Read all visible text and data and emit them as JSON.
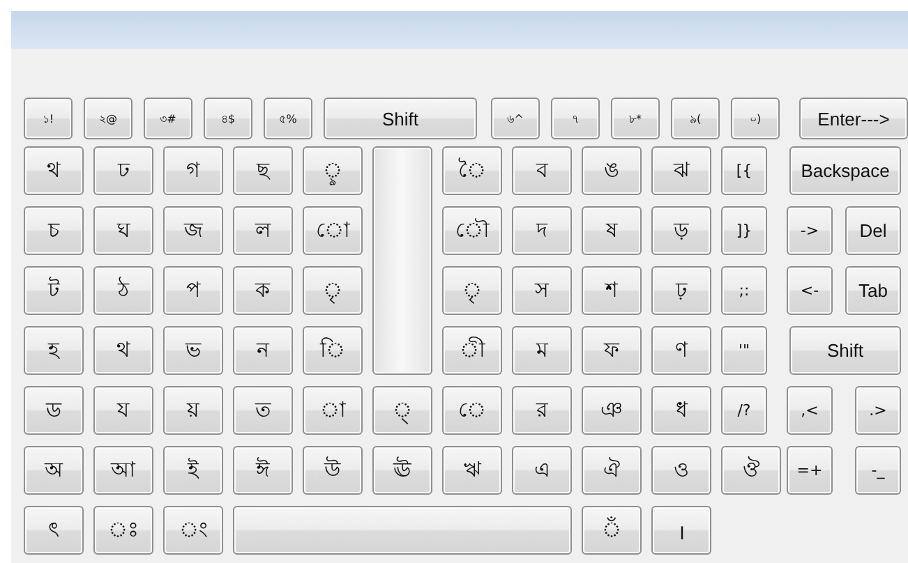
{
  "number_row": [
    {
      "label": "১!",
      "kind": "small"
    },
    {
      "label": "২@",
      "kind": "small"
    },
    {
      "label": "৩#",
      "kind": "small"
    },
    {
      "label": "৪$",
      "kind": "small"
    },
    {
      "label": "৫%",
      "kind": "small"
    },
    {
      "label": "Shift",
      "kind": "shift"
    },
    {
      "label": "৬^",
      "kind": "small"
    },
    {
      "label": "৭",
      "kind": "small"
    },
    {
      "label": "৮*",
      "kind": "small"
    },
    {
      "label": "৯(",
      "kind": "small"
    },
    {
      "label": "০)",
      "kind": "small"
    },
    {
      "label": "Enter--->",
      "kind": "enter"
    }
  ],
  "rows": [
    {
      "keys": [
        {
          "label": "থ",
          "kind": "letter"
        },
        {
          "label": "ঢ",
          "kind": "letter"
        },
        {
          "label": "গ",
          "kind": "letter"
        },
        {
          "label": "ছ",
          "kind": "letter"
        },
        {
          "label": "ৢ",
          "kind": "letter"
        },
        {
          "kind": "blank"
        },
        {
          "label": "ৈ",
          "kind": "letter"
        },
        {
          "label": "ব",
          "kind": "letter"
        },
        {
          "label": "ঙ",
          "kind": "letter"
        },
        {
          "label": "ঝ",
          "kind": "letter"
        },
        {
          "label": "[{",
          "kind": "punct"
        }
      ],
      "side": [
        {
          "label": "Backspace",
          "kind": "wide"
        }
      ]
    },
    {
      "keys": [
        {
          "label": "চ",
          "kind": "letter"
        },
        {
          "label": "ঘ",
          "kind": "letter"
        },
        {
          "label": "জ",
          "kind": "letter"
        },
        {
          "label": "ল",
          "kind": "letter"
        },
        {
          "label": "ো",
          "kind": "letter"
        },
        {
          "label": "ৌ",
          "kind": "letter"
        },
        {
          "label": "দ",
          "kind": "letter"
        },
        {
          "label": "ষ",
          "kind": "letter"
        },
        {
          "label": "ড়",
          "kind": "letter"
        },
        {
          "label": "]}",
          "kind": "punct"
        }
      ],
      "side": [
        {
          "label": "->",
          "kind": "punct"
        },
        {
          "label": "Del",
          "kind": "mid"
        }
      ]
    },
    {
      "keys": [
        {
          "label": "ট",
          "kind": "letter"
        },
        {
          "label": "ঠ",
          "kind": "letter"
        },
        {
          "label": "প",
          "kind": "letter"
        },
        {
          "label": "ক",
          "kind": "letter"
        },
        {
          "label": "ৃ",
          "kind": "letter"
        },
        {
          "label": "ৃ",
          "kind": "letter"
        },
        {
          "label": "স",
          "kind": "letter"
        },
        {
          "label": "শ",
          "kind": "letter"
        },
        {
          "label": "ঢ়",
          "kind": "letter"
        },
        {
          "label": ";:",
          "kind": "punct"
        }
      ],
      "side": [
        {
          "label": "<-",
          "kind": "punct"
        },
        {
          "label": "Tab",
          "kind": "mid"
        }
      ]
    },
    {
      "keys": [
        {
          "label": "হ",
          "kind": "letter"
        },
        {
          "label": "থ",
          "kind": "letter"
        },
        {
          "label": "ভ",
          "kind": "letter"
        },
        {
          "label": "ন",
          "kind": "letter"
        },
        {
          "label": "ি",
          "kind": "letter"
        },
        {
          "label": "ী",
          "kind": "letter"
        },
        {
          "label": "ম",
          "kind": "letter"
        },
        {
          "label": "ফ",
          "kind": "letter"
        },
        {
          "label": "ণ",
          "kind": "letter"
        },
        {
          "label": "'\"",
          "kind": "punct"
        }
      ],
      "side": [
        {
          "label": "Shift",
          "kind": "wide"
        }
      ]
    },
    {
      "keys": [
        {
          "label": "ড",
          "kind": "letter"
        },
        {
          "label": "য",
          "kind": "letter"
        },
        {
          "label": "য়",
          "kind": "letter"
        },
        {
          "label": "ত",
          "kind": "letter"
        },
        {
          "label": "া",
          "kind": "letter"
        },
        {
          "label": "্",
          "kind": "letter"
        },
        {
          "label": "ে",
          "kind": "letter"
        },
        {
          "label": "র",
          "kind": "letter"
        },
        {
          "label": "ঞ",
          "kind": "letter"
        },
        {
          "label": "ধ",
          "kind": "letter"
        },
        {
          "label": "/?",
          "kind": "punct"
        }
      ],
      "side": [
        {
          "label": ",<",
          "kind": "punct"
        },
        {
          "label": ".>",
          "kind": "punct"
        }
      ]
    },
    {
      "keys": [
        {
          "label": "অ",
          "kind": "letter"
        },
        {
          "label": "আ",
          "kind": "letter"
        },
        {
          "label": "ই",
          "kind": "letter"
        },
        {
          "label": "ঈ",
          "kind": "letter"
        },
        {
          "label": "উ",
          "kind": "letter"
        },
        {
          "label": "ঊ",
          "kind": "letter"
        },
        {
          "label": "ঋ",
          "kind": "letter"
        },
        {
          "label": "এ",
          "kind": "letter"
        },
        {
          "label": "ঐ",
          "kind": "letter"
        },
        {
          "label": "ও",
          "kind": "letter"
        },
        {
          "label": "ঔ",
          "kind": "letter"
        }
      ],
      "side": [
        {
          "label": "=+",
          "kind": "punct"
        },
        {
          "label": "-_",
          "kind": "punct"
        }
      ]
    },
    {
      "keys": [
        {
          "label": "ৎ",
          "kind": "letter"
        },
        {
          "label": "ঃ",
          "kind": "letter"
        },
        {
          "label": "ং",
          "kind": "letter"
        },
        {
          "kind": "space"
        },
        {
          "label": "ঁ",
          "kind": "letter"
        },
        {
          "label": "।",
          "kind": "letter"
        }
      ],
      "side": []
    }
  ]
}
